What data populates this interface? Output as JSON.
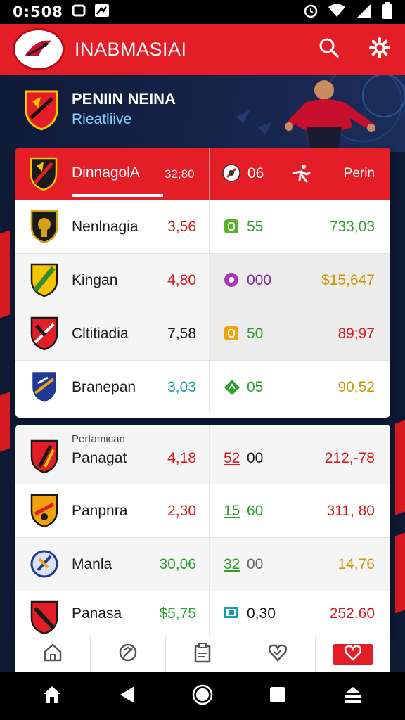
{
  "status_bar": {
    "time": "0:508",
    "icons": [
      "clipboard-icon",
      "image-icon",
      "alarm-icon",
      "wifi-icon",
      "signal-icon",
      "battery-icon"
    ]
  },
  "app_bar": {
    "title": "INABMASIAI",
    "actions": [
      "search-icon",
      "gear-icon"
    ]
  },
  "hero": {
    "title": "PENIIN NEINA",
    "subtitle": "Rieatliive"
  },
  "header": {
    "team": "DinnagolA",
    "score": "32;80",
    "number": "06",
    "label": "Perin"
  },
  "rows_group_1": [
    {
      "team": "Nenlnagia",
      "odds": "3,56",
      "odds_color": "#d71920",
      "mid_icon": "square-icon",
      "mid_color": "#55b62a",
      "mid_val": "55",
      "mid_val_color": "#2e9e2e",
      "right_val": "733,03",
      "right_color": "#2e9e2e"
    },
    {
      "team": "Kingan",
      "odds": "4,80",
      "odds_color": "#d71920",
      "mid_icon": "circle-icon",
      "mid_color": "#a53bb0",
      "mid_val": "000",
      "mid_val_color": "#7a2d9b",
      "right_val": "$15,647",
      "right_color": "#c79a00"
    },
    {
      "team": "Cltitiadia",
      "odds": "7,58",
      "odds_color": "#1a1a1a",
      "mid_icon": "square-icon",
      "mid_color": "#f2a20c",
      "mid_val": "50",
      "mid_val_color": "#2e9e2e",
      "right_val": "89;97",
      "right_color": "#d71920"
    },
    {
      "team": "Branepan",
      "odds": "3,03",
      "odds_color": "#14a39a",
      "mid_icon": "diamond-icon",
      "mid_color": "#2e9e2e",
      "mid_val": "05",
      "mid_val_color": "#2e9e2e",
      "right_val": "90,52",
      "right_color": "#c79a00"
    }
  ],
  "section_2": {
    "title": "Pertamican"
  },
  "rows_group_2": [
    {
      "team": "Panagat",
      "odds": "4,18",
      "odds_color": "#d71920",
      "mid_prefix": "52",
      "mid_prefix_color": "#d71920",
      "mid_val": "00",
      "mid_val_color": "#1a1a1a",
      "right_val": "212,-78",
      "right_color": "#d71920"
    },
    {
      "team": "Panpnra",
      "odds": "2,30",
      "odds_color": "#d71920",
      "mid_prefix": "15",
      "mid_prefix_color": "#2e9e2e",
      "mid_val": "60",
      "mid_val_color": "#2e9e2e",
      "right_val": "311, 80",
      "right_color": "#d71920"
    },
    {
      "team": "Manla",
      "odds": "30,06",
      "odds_color": "#2e9e2e",
      "mid_prefix": "32",
      "mid_prefix_color": "#2e9e2e",
      "mid_val": "00",
      "mid_val_color": "#666666",
      "right_val": "14,76",
      "right_color": "#c79a00"
    },
    {
      "team": "Panasa",
      "odds": "$5,75",
      "odds_color": "#2e9e2e",
      "mid_prefix": "",
      "mid_prefix_color": "#1a9ab0",
      "mid_val": "0,30",
      "mid_val_color": "#1a1a1a",
      "right_val": "252.60",
      "right_color": "#d71920"
    }
  ],
  "tab_bar": {
    "tabs": [
      "home-icon",
      "stadium-icon",
      "clipboard-icon",
      "heart-icon",
      "heart-active-icon"
    ]
  },
  "nav_bar": {
    "buttons": [
      "home-icon",
      "back-icon",
      "circle-home-icon",
      "square-icon",
      "menu-icon"
    ]
  },
  "colors": {
    "brand_red": "#e41e26",
    "dark_navy": "#0e1a33"
  }
}
